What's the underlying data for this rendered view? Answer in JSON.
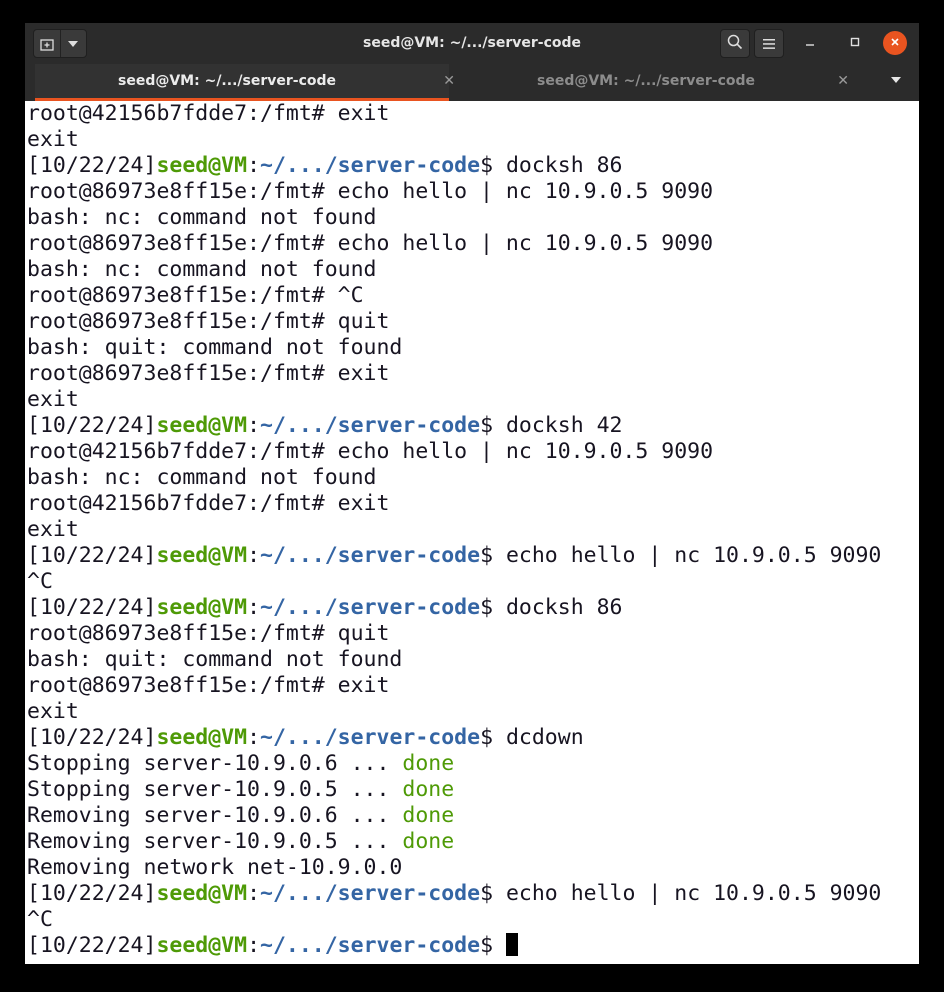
{
  "window": {
    "title": "seed@VM: ~/.../server-code"
  },
  "tabs": [
    {
      "label": "seed@VM: ~/.../server-code",
      "active": true
    },
    {
      "label": "seed@VM: ~/.../server-code",
      "active": false
    }
  ],
  "prompt": {
    "date": "[10/22/24]",
    "user": "seed@VM",
    "sep": ":",
    "path": "~/.../server-code",
    "symbol": "$"
  },
  "lines": {
    "l1": "root@42156b7fdde7:/fmt# exit",
    "l2": "exit",
    "l3_cmd": " docksh 86",
    "l4": "root@86973e8ff15e:/fmt# echo hello | nc 10.9.0.5 9090",
    "l5": "bash: nc: command not found",
    "l6": "root@86973e8ff15e:/fmt# echo hello | nc 10.9.0.5 9090",
    "l7": "bash: nc: command not found",
    "l8": "root@86973e8ff15e:/fmt# ^C",
    "l9": "root@86973e8ff15e:/fmt# quit",
    "l10": "bash: quit: command not found",
    "l11": "root@86973e8ff15e:/fmt# exit",
    "l12": "exit",
    "l13_cmd": " docksh 42",
    "l14": "root@42156b7fdde7:/fmt# echo hello | nc 10.9.0.5 9090",
    "l15": "bash: nc: command not found",
    "l16": "root@42156b7fdde7:/fmt# exit",
    "l17": "exit",
    "l18_cmd": " echo hello | nc 10.9.0.5 9090",
    "l19": "^C",
    "l20_cmd": " docksh 86",
    "l21": "root@86973e8ff15e:/fmt# quit",
    "l22": "bash: quit: command not found",
    "l23": "root@86973e8ff15e:/fmt# exit",
    "l24": "exit",
    "l25_cmd": " dcdown",
    "l26_pre": "Stopping server-10.9.0.6 ... ",
    "l27_pre": "Stopping server-10.9.0.5 ... ",
    "l28_pre": "Removing server-10.9.0.6 ... ",
    "l29_pre": "Removing server-10.9.0.5 ... ",
    "done": "done",
    "l30": "Removing network net-10.9.0.0",
    "l31_cmd": " echo hello | nc 10.9.0.5 9090",
    "l32": "^C",
    "l33_cmd": " "
  },
  "colors": {
    "accent": "#e95420",
    "prompt_user": "#4e9a06",
    "prompt_path": "#3465a4"
  },
  "icons": [
    "new-tab-icon",
    "chevron-down-icon",
    "search-icon",
    "hamburger-menu-icon",
    "minimize-icon",
    "maximize-icon",
    "close-icon"
  ]
}
